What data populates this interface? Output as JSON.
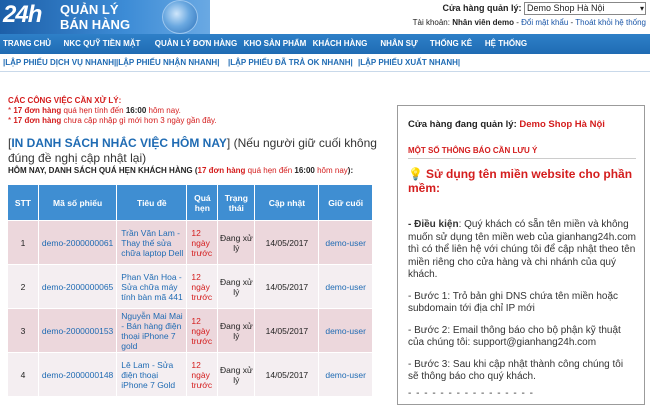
{
  "header": {
    "logo_number": "24h",
    "logo_line1": "QUẢN LÝ",
    "logo_line2": "BÁN HÀNG",
    "store_label": "Cửa hàng quản lý:",
    "store_selected": "Demo Shop Hà Nội",
    "account_label": "Tài khoản:",
    "account_name": "Nhân viên demo",
    "change_password": "Đổi mật khẩu",
    "logout": "Thoát khỏi hệ thống",
    "sep": "-"
  },
  "nav": [
    "TRANG CHỦ",
    "NKC QUỸ TIỀN MẶT",
    "QUẢN LÝ ĐƠN HÀNG",
    "KHO SẢN PHẨM",
    "KHÁCH HÀNG",
    "NHÂN SỰ",
    "THỐNG KÊ",
    "HỆ THỐNG"
  ],
  "subnav": [
    "|LẬP PHIẾU DỊCH VỤ NHANH|",
    "|LẬP PHIẾU NHẬN NHANH|",
    "|LẬP PHIẾU ĐÃ TRẢ OK NHANH|",
    "|LẬP PHIẾU XUẤT NHANH|"
  ],
  "tasks": {
    "title": "CÁC CÔNG VIỆC CẦN XỬ LÝ:",
    "line1": {
      "star": "*",
      "count": "17 đơn hàng",
      "text_a": "quá hẹn tính đến",
      "time": "16:00",
      "text_b": "hôm nay."
    },
    "line2": {
      "star": "*",
      "count": "17 đơn hàng",
      "text": "chưa cập nhập gì mới hơn 3 ngày gần đây."
    }
  },
  "reminder": {
    "open": "[",
    "title": "IN DANH SÁCH NHẮC VIỆC HÔM NAY",
    "close": "]",
    "note": "(Nếu người giữ cuối không đúng đề nghị cập nhật lại)"
  },
  "today": {
    "label": "HÔM NAY, DANH SÁCH QUÁ HẸN KHÁCH HÀNG",
    "open": "(",
    "count": "17 đơn hàng",
    "text_a": "quá hẹn đến",
    "time": "16:00",
    "text_b": "hôm nay",
    "close": "):"
  },
  "table": {
    "headers": [
      "STT",
      "Mã số phiếu",
      "Tiêu đề",
      "Quá hẹn",
      "Trạng thái",
      "Cập nhật",
      "Giữ cuối"
    ],
    "rows": [
      {
        "stt": "1",
        "code": "demo-2000000061",
        "title": "Trần Văn Lam - Thay thế sửa chữa laptop Dell",
        "overdue": "12 ngày trước",
        "status": "Đang xử lý",
        "updated": "14/05/2017",
        "holder": "demo-user"
      },
      {
        "stt": "2",
        "code": "demo-2000000065",
        "title": "Phan Văn Hoa - Sửa chữa máy tính bàn mã 441",
        "overdue": "12 ngày trước",
        "status": "Đang xử lý",
        "updated": "14/05/2017",
        "holder": "demo-user"
      },
      {
        "stt": "3",
        "code": "demo-2000000153",
        "title": "Nguyễn Mai Mai - Bán hàng điện thoại iPhone 7 gold",
        "overdue": "12 ngày trước",
        "status": "Đang xử lý",
        "updated": "14/05/2017",
        "holder": "demo-user"
      },
      {
        "stt": "4",
        "code": "demo-2000000148",
        "title": "Lê Lam - Sửa điện thoại iPhone 7 Gold",
        "overdue": "12 ngày trước",
        "status": "Đang xử lý",
        "updated": "14/05/2017",
        "holder": "demo-user"
      }
    ]
  },
  "panel": {
    "store_label": "Cửa hàng đang quản lý:",
    "store_name": "Demo Shop Hà Nội",
    "notice_title": "MỘT SỐ THÔNG BÁO CẦN LƯU Ý",
    "feature_title": "Sử dụng tên miền website cho phần mềm:",
    "condition_label": "- Điều kiện",
    "condition_text": ": Quý khách có sẵn tên miền và không muốn sử dụng tên miền web của gianhang24h.com thì có thể liên hệ với chúng tôi để cập nhật theo tên miền riêng cho cửa hàng và chi nhánh của quý khách.",
    "step1": "- Bước 1: Trỏ bản ghi DNS chứa tên miền hoặc subdomain tới địa chỉ IP mới",
    "step2": "- Bước 2: Email thông báo cho bộ phận kỹ thuật của chúng tôi: support@gianhang24h.com",
    "step3": "- Bước 3: Sau khi cập nhật thành công chúng tôi sẽ thông báo cho quý khách.",
    "dashes": "- - - - - - - - - - - - - - - -"
  },
  "colors": {
    "nav_blue": "#1f6bb3",
    "table_header": "#3f8ed2",
    "alert_red": "#d41d1d",
    "row_pink": "#ecd7dc"
  }
}
